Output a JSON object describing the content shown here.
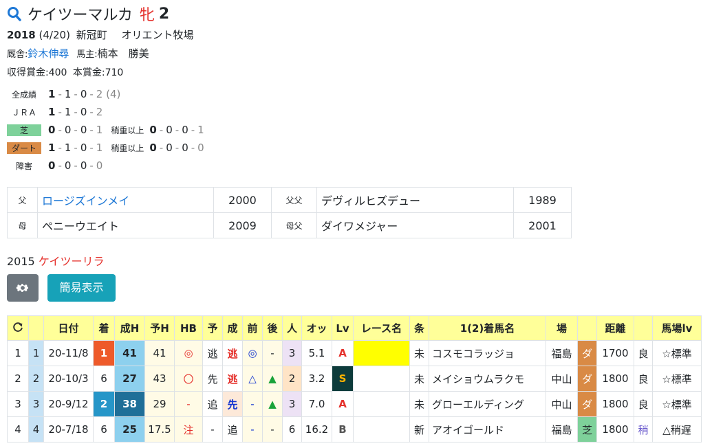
{
  "horse": {
    "name": "ケイツーマルカ",
    "sex": "牝",
    "age": "2",
    "birth_year": "2018",
    "birth_date": "(4/20)",
    "area": "新冠町",
    "breeder": "オリエント牧場",
    "trainer_label": "厩舎:",
    "trainer": "鈴木伸尋",
    "owner_label": "馬主:",
    "owner": "楠本　勝美",
    "earnings": "収得賞金:400",
    "prize": "本賞金:710"
  },
  "records": [
    {
      "label": "全成績",
      "style": "plain",
      "w": "1",
      "s": "1",
      "t": "0",
      "o": "2 (4)",
      "sub": null
    },
    {
      "label": "ＪＲＡ",
      "style": "plain",
      "w": "1",
      "s": "1",
      "t": "0",
      "o": "2",
      "sub": null
    },
    {
      "label": "芝",
      "style": "turf",
      "w": "0",
      "s": "0",
      "t": "0",
      "o": "1",
      "sub": {
        "label": "稍重以上",
        "w": "0",
        "s": "0",
        "t": "0",
        "o": "1"
      }
    },
    {
      "label": "ダート",
      "style": "dirt",
      "w": "1",
      "s": "1",
      "t": "0",
      "o": "1",
      "sub": {
        "label": "稍重以上",
        "w": "0",
        "s": "0",
        "t": "0",
        "o": "0"
      }
    },
    {
      "label": "障害",
      "style": "plain",
      "w": "0",
      "s": "0",
      "t": "0",
      "o": "0",
      "sub": null
    }
  ],
  "pedigree": {
    "sire_label": "父",
    "sire": "ロージズインメイ",
    "sire_year": "2000",
    "sire_sire_label": "父父",
    "sire_sire": "デヴィルヒズデュー",
    "sire_sire_year": "1989",
    "dam_label": "母",
    "dam": "ペニーウエイト",
    "dam_year": "2009",
    "dam_sire_label": "母父",
    "dam_sire": "ダイワメジャー",
    "dam_sire_year": "2001"
  },
  "sibling": {
    "year": "2015",
    "name": "ケイツーリラ"
  },
  "buttons": {
    "settings_icon": "gear-icon",
    "simple_view": "簡易表示"
  },
  "table": {
    "reload_icon": "reload-icon",
    "headers": [
      "",
      "",
      "日付",
      "着",
      "成H",
      "予H",
      "HB",
      "予",
      "成",
      "前",
      "後",
      "人",
      "オッ",
      "Lv",
      "レース名",
      "条",
      "1(2)着馬名",
      "場",
      "",
      "距離",
      "",
      "馬場lv"
    ],
    "rows": [
      {
        "no": "1",
        "idx": "1",
        "date": "20-11/8",
        "finish": "1",
        "seiH": "41",
        "yoH": "41",
        "hb": "◎",
        "yo": "逃",
        "sei": "逃",
        "mae": "◎",
        "ato": "-",
        "ninki": "3",
        "odds": "5.1",
        "lv": "A",
        "race": "",
        "jo": "未",
        "winner": "コスモコラッジョ",
        "place": "福島",
        "surface": "ダ",
        "dist": "1700",
        "baba": "良",
        "babalv": "☆標準"
      },
      {
        "no": "2",
        "idx": "2",
        "date": "20-10/3",
        "finish": "6",
        "seiH": "27",
        "yoH": "43",
        "hb": "〇",
        "yo": "先",
        "sei": "逃",
        "mae": "△",
        "ato": "▲",
        "ninki": "2",
        "odds": "3.2",
        "lv": "S",
        "race": "",
        "jo": "未",
        "winner": "メイショウムラクモ",
        "place": "中山",
        "surface": "ダ",
        "dist": "1800",
        "baba": "良",
        "babalv": "☆標準"
      },
      {
        "no": "3",
        "idx": "3",
        "date": "20-9/12",
        "finish": "2",
        "seiH": "38",
        "yoH": "29",
        "hb": "-",
        "yo": "追",
        "sei": "先",
        "mae": "-",
        "ato": "▲",
        "ninki": "3",
        "odds": "7.0",
        "lv": "A",
        "race": "",
        "jo": "未",
        "winner": "グローエルディング",
        "place": "中山",
        "surface": "ダ",
        "dist": "1800",
        "baba": "良",
        "babalv": "☆標準"
      },
      {
        "no": "4",
        "idx": "4",
        "date": "20-7/18",
        "finish": "6",
        "seiH": "25",
        "yoH": "17.5",
        "hb": "注",
        "yo": "-",
        "sei": "追",
        "mae": "-",
        "ato": "-",
        "ninki": "6",
        "odds": "16.2",
        "lv": "B",
        "race": "",
        "jo": "新",
        "winner": "アオイゴールド",
        "place": "福島",
        "surface": "芝",
        "dist": "1800",
        "baba": "稍",
        "babalv": "△稍遅"
      }
    ]
  }
}
